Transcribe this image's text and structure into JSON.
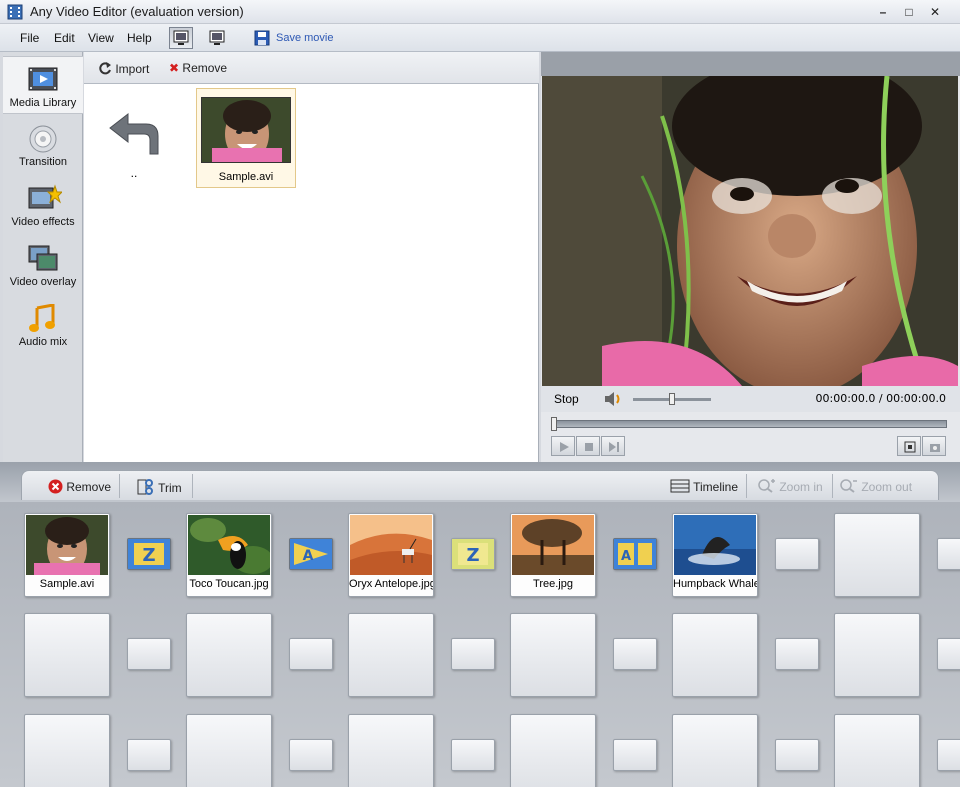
{
  "window": {
    "title": "Any Video Editor (evaluation version)"
  },
  "menu": {
    "items": [
      "File",
      "Edit",
      "View",
      "Help"
    ],
    "save_movie": "Save movie"
  },
  "sidebar": {
    "items": [
      {
        "label": "Media Library",
        "icon": "film-icon",
        "active": true
      },
      {
        "label": "Transition",
        "icon": "transition-icon"
      },
      {
        "label": "Video effects",
        "icon": "video-effects-icon"
      },
      {
        "label": "Video overlay",
        "icon": "video-overlay-icon"
      },
      {
        "label": "Audio mix",
        "icon": "music-note-icon"
      }
    ]
  },
  "library": {
    "import_label": "Import",
    "remove_label": "Remove",
    "back_label": "..",
    "items": [
      {
        "name": "Sample.avi"
      }
    ]
  },
  "preview": {
    "stop_label": "Stop",
    "time": "00:00:00.0 / 00:00:00.0",
    "volume_level": 0.5,
    "seek_position": 0
  },
  "storyboard": {
    "remove_label": "Remove",
    "trim_label": "Trim",
    "timeline_label": "Timeline",
    "zoom_in_label": "Zoom in",
    "zoom_out_label": "Zoom out",
    "clips": [
      {
        "name": "Sample.avi"
      },
      {
        "name": "Toco Toucan.jpg"
      },
      {
        "name": "Oryx Antelope.jpg"
      },
      {
        "name": "Tree.jpg"
      },
      {
        "name": "Humpback Whale.jpg"
      }
    ],
    "transitions": [
      "Z",
      "A",
      "Z",
      "A"
    ]
  },
  "colors": {
    "accent_blue": "#2d58b4",
    "remove_red": "#d42020"
  }
}
